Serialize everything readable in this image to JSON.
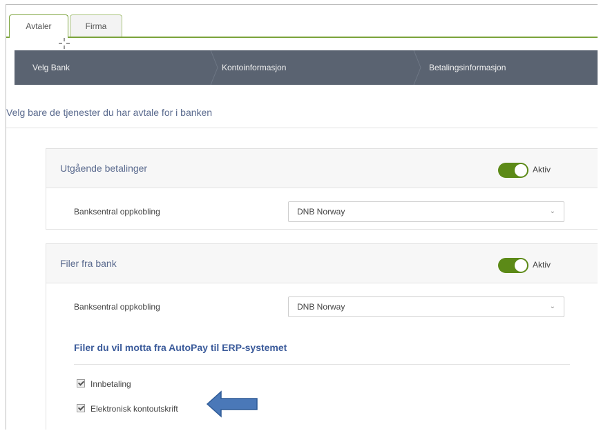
{
  "tabs": [
    {
      "label": "Avtaler",
      "active": true
    },
    {
      "label": "Firma",
      "active": false
    }
  ],
  "steps": [
    {
      "label": "Velg Bank"
    },
    {
      "label": "Kontoinformasjon"
    },
    {
      "label": "Betalingsinformasjon"
    }
  ],
  "intro": "Velg bare de tjenester du har avtale for i banken",
  "panels": {
    "outgoing": {
      "title": "Utgående betalinger",
      "toggle_label": "Aktiv",
      "toggle_on": true,
      "bank_label": "Banksentral oppkobling",
      "bank_value": "DNB Norway"
    },
    "files": {
      "title": "Filer fra bank",
      "toggle_label": "Aktiv",
      "toggle_on": true,
      "bank_label": "Banksentral oppkobling",
      "bank_value": "DNB Norway",
      "subtitle": "Filer du vil motta fra AutoPay til ERP-systemet",
      "options": [
        {
          "label": "Innbetaling",
          "checked": true
        },
        {
          "label": "Elektronisk kontoutskrift",
          "checked": true
        }
      ]
    }
  },
  "colors": {
    "accent_green": "#5c8a17",
    "tab_border": "#7aa33a",
    "step_bar": "#5a6371",
    "arrow": "#4a78b8"
  },
  "icons": {
    "select_chevron": "chevron-down-icon",
    "arrow": "arrow-left-icon",
    "cursor": "crosshair-cursor-icon"
  }
}
